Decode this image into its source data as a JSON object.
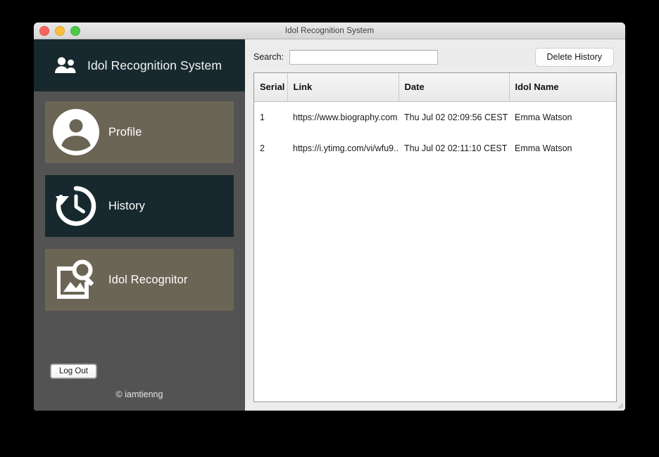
{
  "window": {
    "title": "Idol Recognition System",
    "traffic_lights": [
      {
        "name": "close",
        "color": "#f9655d"
      },
      {
        "name": "minimize",
        "color": "#fbbd3d"
      },
      {
        "name": "maximize",
        "color": "#4fc948"
      }
    ]
  },
  "sidebar": {
    "brand": {
      "icon": "people-icon",
      "title": "Idol Recognition System",
      "background": "#17292e"
    },
    "items": [
      {
        "label": "Profile",
        "icon": "user-circle-icon",
        "active": false
      },
      {
        "label": "History",
        "icon": "history-clock-icon",
        "active": true
      },
      {
        "label": "Idol Recognitor",
        "icon": "image-search-icon",
        "active": false
      }
    ],
    "logout_label": "Log Out",
    "footer": "© iamtienng",
    "colors": {
      "body": "#535353",
      "item_inactive": "#6b6555",
      "item_active": "#17292e"
    }
  },
  "main": {
    "search": {
      "label": "Search:",
      "value": "",
      "placeholder": ""
    },
    "delete_button_label": "Delete History",
    "table": {
      "columns": [
        "Serial",
        "Link",
        "Date",
        "Idol Name"
      ],
      "rows": [
        {
          "serial": "1",
          "link": "https://www.biography.com...",
          "date": "Thu Jul 02 02:09:56 CEST ...",
          "idol": "Emma Watson"
        },
        {
          "serial": "2",
          "link": "https://i.ytimg.com/vi/wfu9...",
          "date": "Thu Jul 02 02:11:10 CEST ...",
          "idol": "Emma Watson"
        }
      ]
    }
  }
}
